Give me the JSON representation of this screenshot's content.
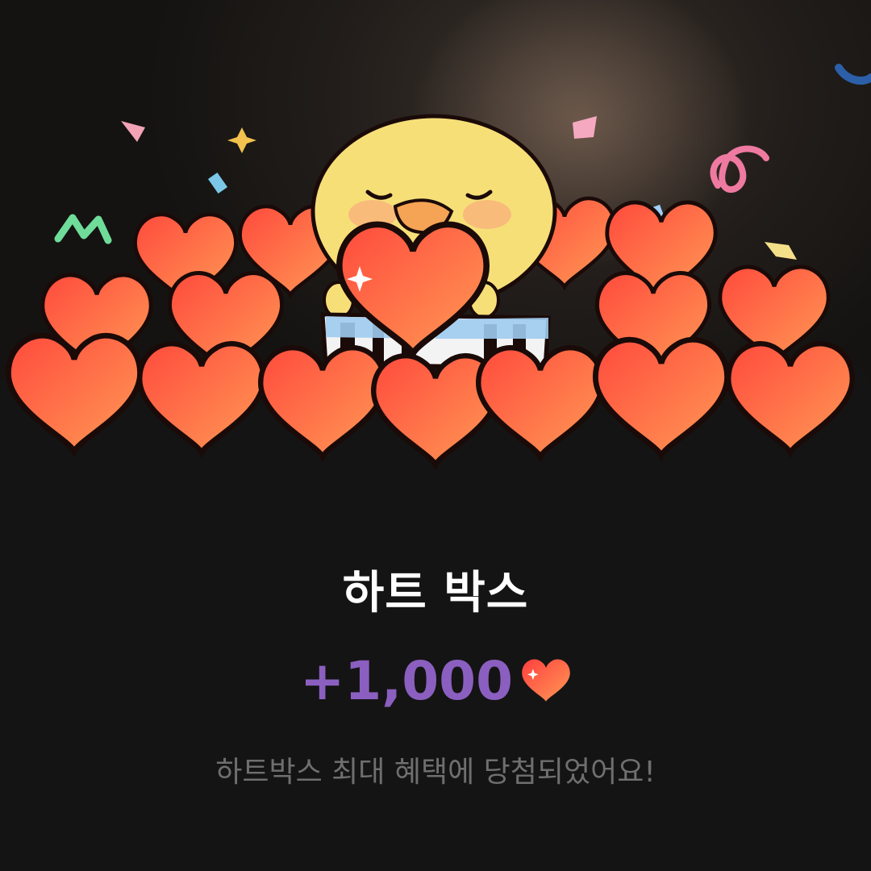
{
  "dialog": {
    "title": "하트 박스",
    "reward_amount": "+1,000",
    "reward_icon": "heart-icon",
    "message": "하트박스 최대 혜택에 당첨되었어요!"
  },
  "colors": {
    "background": "#141414",
    "title": "#ffffff",
    "reward_amount": "#8b5fc0",
    "message": "#6f6f6f",
    "heart": "#ff5a4a"
  },
  "illustration": {
    "icons": [
      "background-photo",
      "chick-character-icon",
      "heart-pile-icon",
      "gift-box-icon",
      "confetti-icon"
    ]
  }
}
